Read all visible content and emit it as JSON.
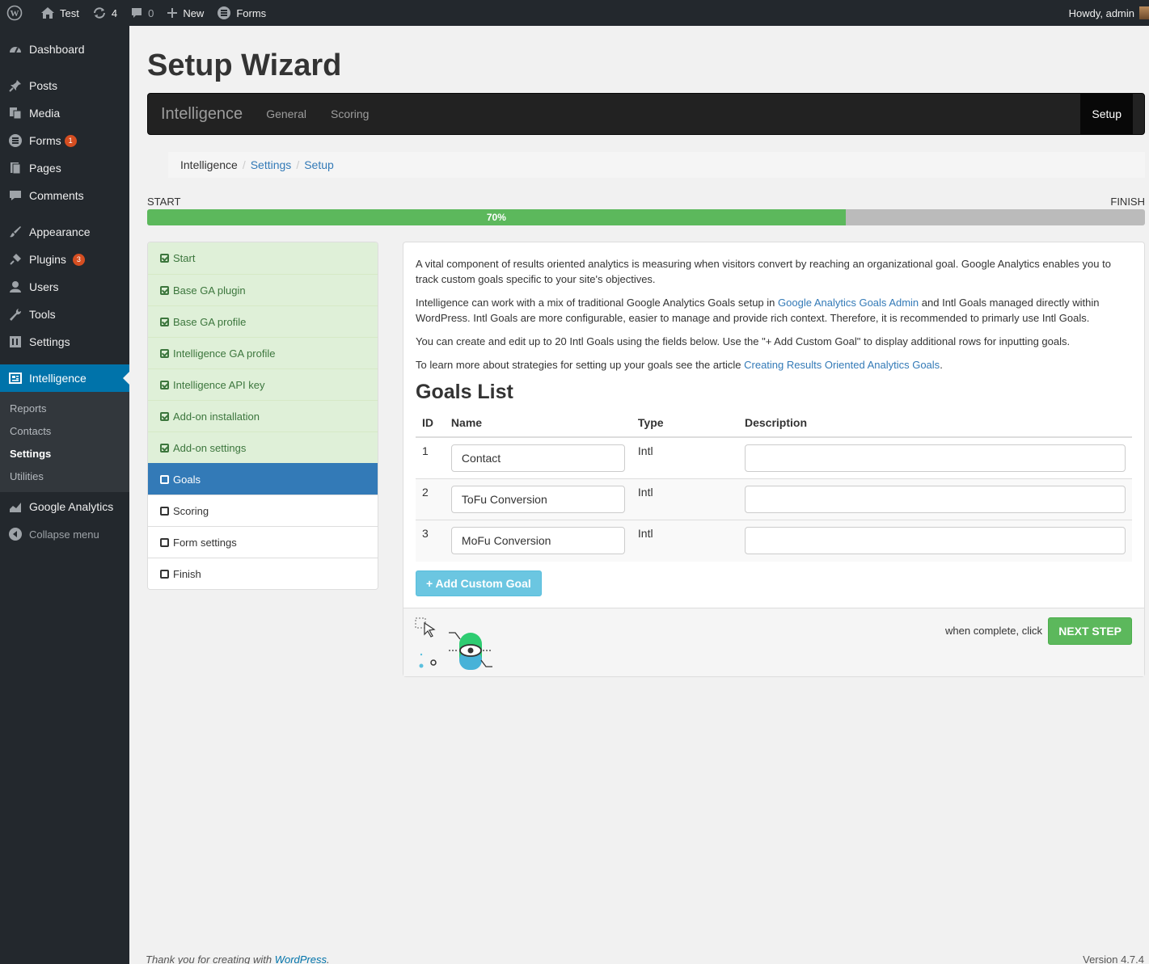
{
  "adminbar": {
    "site": "Test",
    "updates": "4",
    "comments": "0",
    "new": "New",
    "forms": "Forms",
    "howdy": "Howdy, admin"
  },
  "sidebar": {
    "items": [
      {
        "label": "Dashboard",
        "icon": "dashboard-icon"
      },
      {
        "label": "Posts",
        "icon": "pin-icon"
      },
      {
        "label": "Media",
        "icon": "media-icon"
      },
      {
        "label": "Forms",
        "icon": "forms-icon",
        "badge": "1"
      },
      {
        "label": "Pages",
        "icon": "pages-icon"
      },
      {
        "label": "Comments",
        "icon": "comment-icon"
      },
      {
        "label": "Appearance",
        "icon": "brush-icon"
      },
      {
        "label": "Plugins",
        "icon": "plug-icon",
        "badge": "3"
      },
      {
        "label": "Users",
        "icon": "user-icon"
      },
      {
        "label": "Tools",
        "icon": "wrench-icon"
      },
      {
        "label": "Settings",
        "icon": "settings-icon"
      },
      {
        "label": "Intelligence",
        "icon": "intelligence-icon"
      }
    ],
    "submenu": [
      "Reports",
      "Contacts",
      "Settings",
      "Utilities"
    ],
    "google_analytics": "Google Analytics",
    "collapse": "Collapse menu"
  },
  "page": {
    "title": "Setup Wizard"
  },
  "navbar": {
    "brand": "Intelligence",
    "links": [
      "General",
      "Scoring"
    ],
    "right": "Setup"
  },
  "breadcrumb": [
    "Intelligence",
    "Settings",
    "Setup"
  ],
  "progress": {
    "start": "START",
    "finish": "FINISH",
    "label": "70%",
    "value": 0.7,
    "color": "#5cb85c"
  },
  "steps": [
    {
      "label": "Start",
      "state": "done"
    },
    {
      "label": "Base GA plugin",
      "state": "done"
    },
    {
      "label": "Base GA profile",
      "state": "done"
    },
    {
      "label": "Intelligence GA profile",
      "state": "done"
    },
    {
      "label": "Intelligence API key",
      "state": "done"
    },
    {
      "label": "Add-on installation",
      "state": "done"
    },
    {
      "label": "Add-on settings",
      "state": "done"
    },
    {
      "label": "Goals",
      "state": "active"
    },
    {
      "label": "Scoring",
      "state": "todo"
    },
    {
      "label": "Form settings",
      "state": "todo"
    },
    {
      "label": "Finish",
      "state": "todo"
    }
  ],
  "content": {
    "p1": "A vital component of results oriented analytics is measuring when visitors convert by reaching an organizational goal. Google Analytics enables you to track custom goals specific to your site's objectives.",
    "p2_a": "Intelligence can work with a mix of traditional Google Analytics Goals setup in ",
    "p2_link": "Google Analytics Goals Admin",
    "p2_b": " and Intl Goals managed directly within WordPress. Intl Goals are more configurable, easier to manage and provide rich context. Therefore, it is recommended to primarly use Intl Goals.",
    "p3": "You can create and edit up to 20 Intl Goals using the fields below. Use the \"+ Add Custom Goal\" to display additional rows for inputting goals.",
    "p4_a": "To learn more about strategies for setting up your goals see the article ",
    "p4_link": "Creating Results Oriented Analytics Goals",
    "p4_b": ".",
    "goals_title": "Goals List",
    "columns": [
      "ID",
      "Name",
      "Type",
      "Description"
    ],
    "goals": [
      {
        "id": "1",
        "name": "Contact",
        "type": "Intl",
        "description": ""
      },
      {
        "id": "2",
        "name": "ToFu Conversion",
        "type": "Intl",
        "description": ""
      },
      {
        "id": "3",
        "name": "MoFu Conversion",
        "type": "Intl",
        "description": ""
      }
    ],
    "add_button": "+ Add Custom Goal",
    "footer_note": "when complete, click",
    "next_button": "NEXT STEP"
  },
  "footer": {
    "thanks": "Thank you for creating with ",
    "wp_link": "WordPress",
    "thanks_end": ".",
    "version": "Version 4.7.4"
  }
}
